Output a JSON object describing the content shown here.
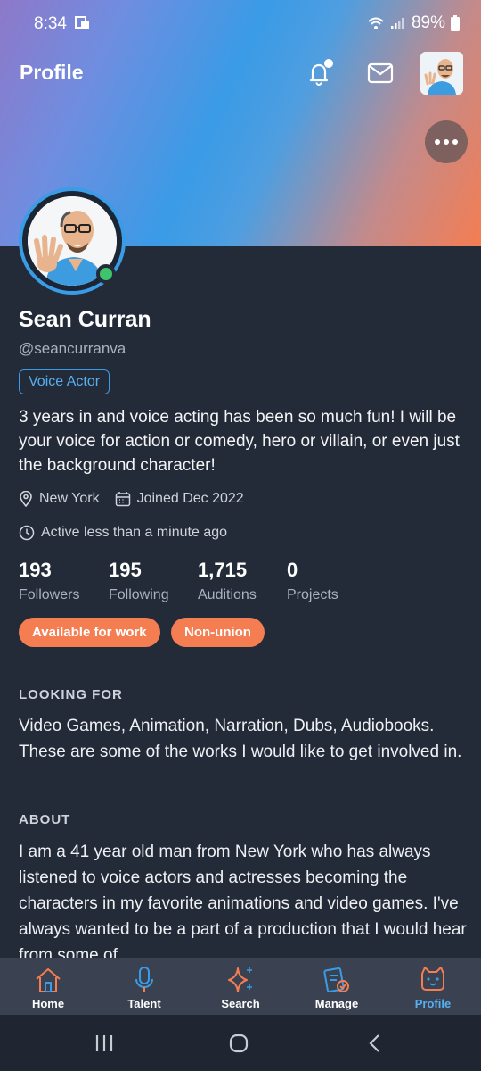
{
  "status": {
    "time": "8:34",
    "battery": "89%"
  },
  "header": {
    "title": "Profile"
  },
  "profile": {
    "name": "Sean Curran",
    "handle": "@seancurranva",
    "role": "Voice Actor",
    "bio": "3 years in and voice acting has been so much fun! I will be your voice for action or comedy, hero or villain, or even just the background character!",
    "location": "New York",
    "joined": "Joined Dec 2022",
    "activity": "Active less than a minute ago",
    "stats": [
      {
        "value": "193",
        "label": "Followers"
      },
      {
        "value": "195",
        "label": "Following"
      },
      {
        "value": "1,715",
        "label": "Auditions"
      },
      {
        "value": "0",
        "label": "Projects"
      }
    ],
    "tags": [
      "Available for work",
      "Non-union"
    ]
  },
  "sections": {
    "looking_for": {
      "title": "LOOKING FOR",
      "text": "Video Games, Animation, Narration, Dubs, Audiobooks. These are some of the works I would like to get involved in."
    },
    "about": {
      "title": "ABOUT",
      "text": "I am a 41 year old man from New York who has always listened to voice actors and actresses becoming the characters in my favorite animations and video games. I've always wanted to be a part of a production that I would hear from some of"
    }
  },
  "nav": [
    {
      "label": "Home",
      "icon": "home-icon"
    },
    {
      "label": "Talent",
      "icon": "microphone-icon"
    },
    {
      "label": "Search",
      "icon": "sparkle-search-icon"
    },
    {
      "label": "Manage",
      "icon": "clipboard-check-icon"
    },
    {
      "label": "Profile",
      "icon": "cat-profile-icon"
    }
  ],
  "colors": {
    "accent": "#3a9be6",
    "tag": "#f47d52",
    "background": "#232a38",
    "online": "#3ec46d"
  }
}
